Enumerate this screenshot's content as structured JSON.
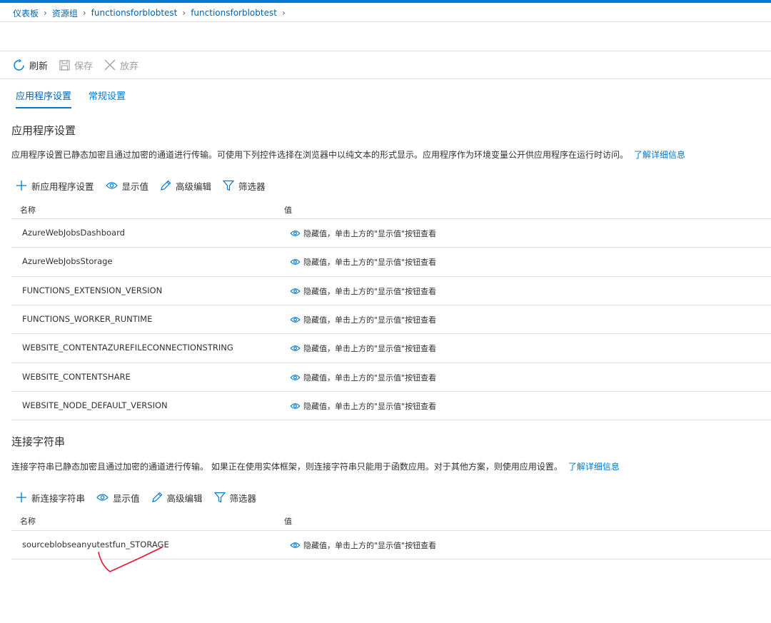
{
  "breadcrumb": [
    "仪表板",
    "资源组",
    "functionsforblobtest",
    "functionsforblobtest"
  ],
  "command_bar": {
    "refresh": "刷新",
    "save": "保存",
    "discard": "放弃"
  },
  "tabs": [
    {
      "label": "应用程序设置",
      "active": true
    },
    {
      "label": "常规设置",
      "active": false
    }
  ],
  "app_settings": {
    "title": "应用程序设置",
    "description": "应用程序设置已静态加密且通过加密的通道进行传输。可使用下列控件选择在浏览器中以纯文本的形式显示。应用程序作为环境变量公开供应用程序在运行时访问。",
    "learn_more": "了解详细信息",
    "toolbar": {
      "add": "新应用程序设置",
      "show_values": "显示值",
      "advanced_edit": "高级编辑",
      "filter": "筛选器"
    },
    "columns": {
      "name": "名称",
      "value": "值"
    },
    "rows": [
      {
        "name": "AzureWebJobsDashboard",
        "value": "隐藏值，单击上方的\"显示值\"按钮查看"
      },
      {
        "name": "AzureWebJobsStorage",
        "value": "隐藏值，单击上方的\"显示值\"按钮查看"
      },
      {
        "name": "FUNCTIONS_EXTENSION_VERSION",
        "value": "隐藏值，单击上方的\"显示值\"按钮查看"
      },
      {
        "name": "FUNCTIONS_WORKER_RUNTIME",
        "value": "隐藏值，单击上方的\"显示值\"按钮查看"
      },
      {
        "name": "WEBSITE_CONTENTAZUREFILECONNECTIONSTRING",
        "value": "隐藏值，单击上方的\"显示值\"按钮查看"
      },
      {
        "name": "WEBSITE_CONTENTSHARE",
        "value": "隐藏值，单击上方的\"显示值\"按钮查看"
      },
      {
        "name": "WEBSITE_NODE_DEFAULT_VERSION",
        "value": "隐藏值，单击上方的\"显示值\"按钮查看"
      }
    ]
  },
  "connection_strings": {
    "title": "连接字符串",
    "description": "连接字符串已静态加密且通过加密的通道进行传输。 如果正在使用实体框架，则连接字符串只能用于函数应用。对于其他方案，则使用应用设置。",
    "learn_more": "了解详细信息",
    "toolbar": {
      "add": "新连接字符串",
      "show_values": "显示值",
      "advanced_edit": "高级编辑",
      "filter": "筛选器"
    },
    "columns": {
      "name": "名称",
      "value": "值"
    },
    "rows": [
      {
        "name": "sourceblobseanyutestfun_STORAGE",
        "value": "隐藏值，单击上方的\"显示值\"按钮查看"
      }
    ]
  },
  "colors": {
    "accent": "#0078d4",
    "link": "#0063b1",
    "annotation": "#e8112d"
  },
  "icons": [
    "refresh-icon",
    "save-icon",
    "close-icon",
    "plus-icon",
    "eye-icon",
    "pencil-icon",
    "filter-icon"
  ]
}
